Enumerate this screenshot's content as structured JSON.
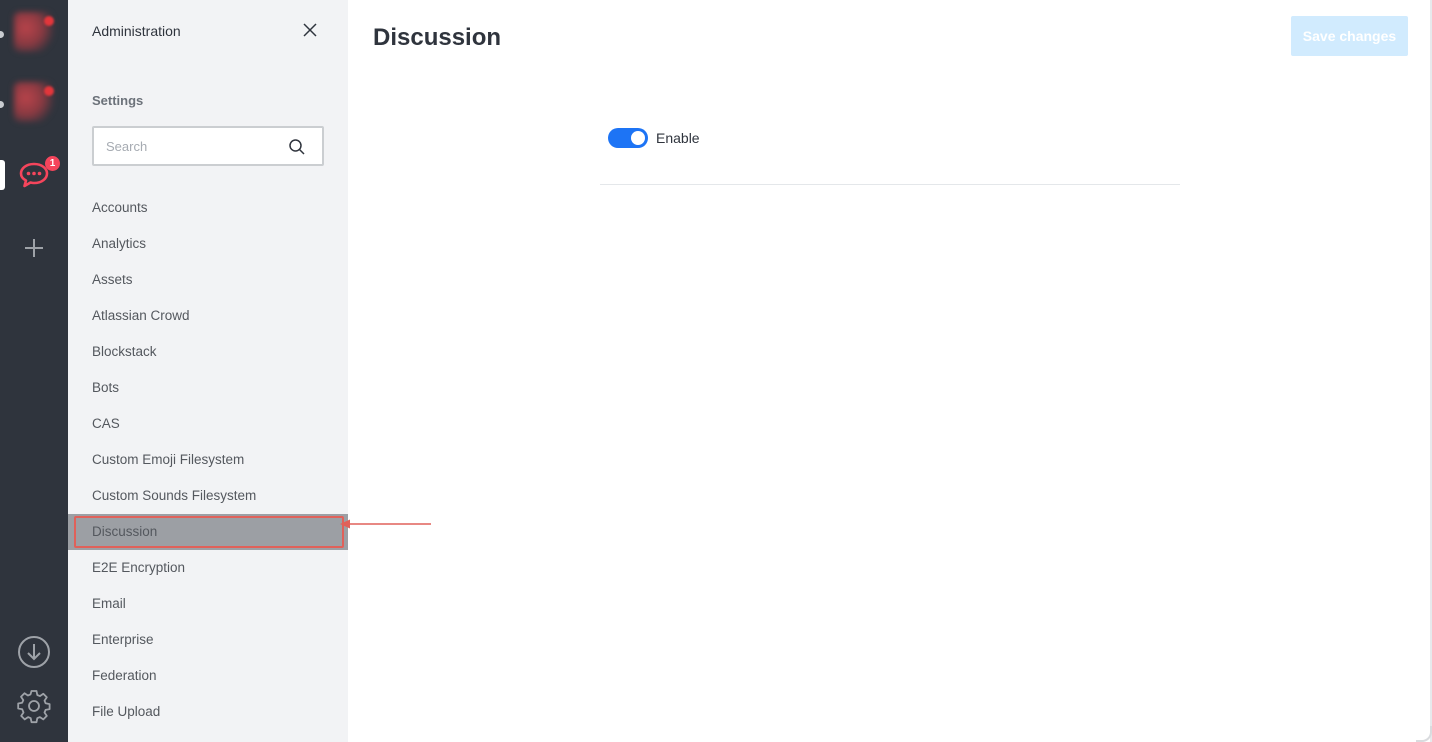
{
  "sidebar": {
    "title": "Administration",
    "section": "Settings",
    "search_placeholder": "Search",
    "items": [
      {
        "label": "Accounts"
      },
      {
        "label": "Analytics"
      },
      {
        "label": "Assets"
      },
      {
        "label": "Atlassian Crowd"
      },
      {
        "label": "Blockstack"
      },
      {
        "label": "Bots"
      },
      {
        "label": "CAS"
      },
      {
        "label": "Custom Emoji Filesystem"
      },
      {
        "label": "Custom Sounds Filesystem"
      },
      {
        "label": "Discussion"
      },
      {
        "label": "E2E Encryption"
      },
      {
        "label": "Email"
      },
      {
        "label": "Enterprise"
      },
      {
        "label": "Federation"
      },
      {
        "label": "File Upload"
      }
    ],
    "active_item": "Discussion"
  },
  "rail": {
    "unread_badge": "1",
    "icons": [
      "server-icon",
      "server-icon",
      "chat-icon",
      "add-icon",
      "download-icon",
      "settings-icon"
    ]
  },
  "main": {
    "title": "Discussion",
    "save_label": "Save changes",
    "enable_label": "Enable",
    "enable_on": true
  },
  "colors": {
    "rail_bg": "#2f343d",
    "sidebar_bg": "#f2f3f5",
    "accent": "#1d74f5",
    "save_disabled": "#d1ebfe",
    "highlight_border": "#e0615a",
    "badge": "#f5455c"
  }
}
